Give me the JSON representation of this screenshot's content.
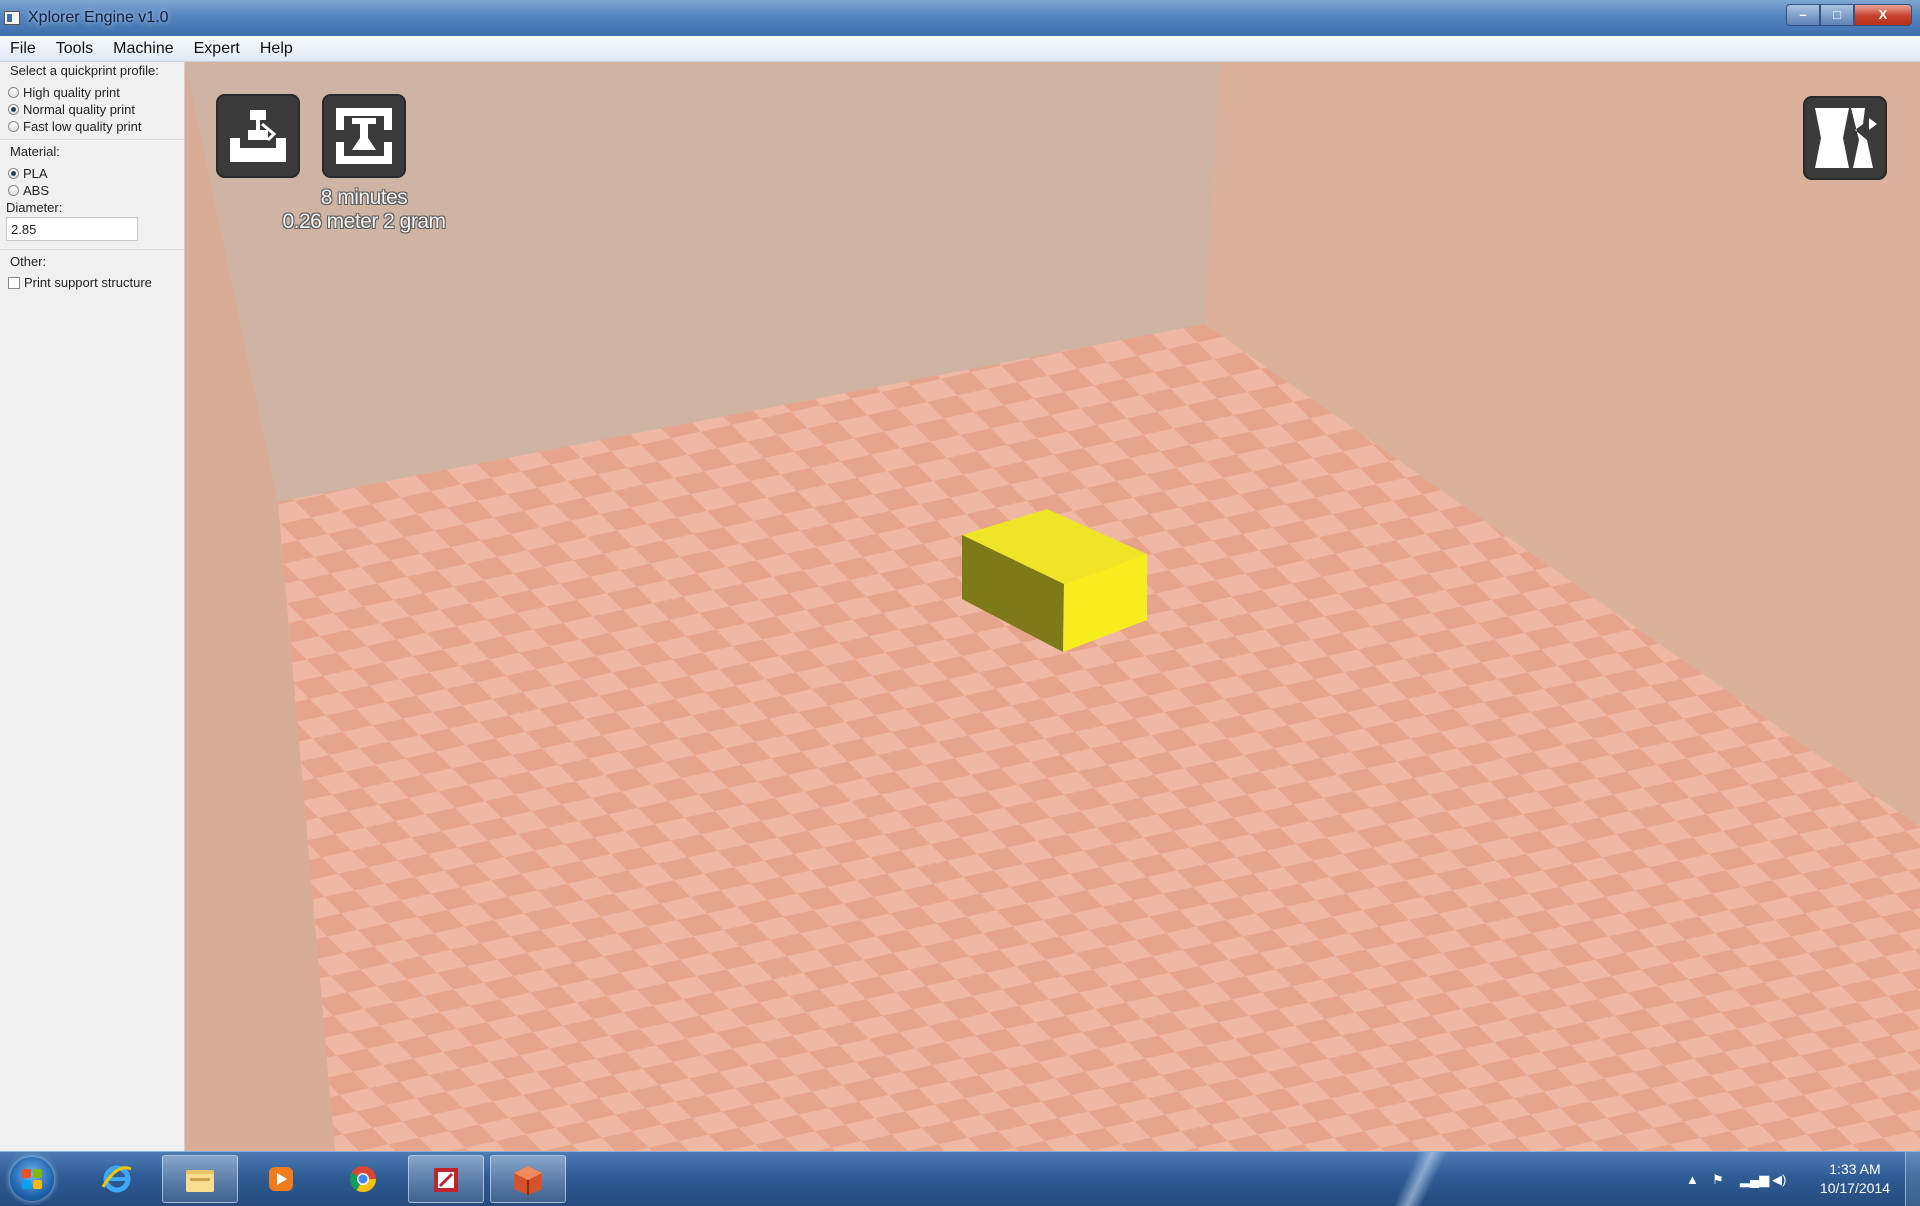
{
  "window": {
    "title": "Xplorer Engine v1.0",
    "controls": {
      "minimize": "–",
      "maximize": "□",
      "close": "X"
    }
  },
  "menu": [
    "File",
    "Tools",
    "Machine",
    "Expert",
    "Help"
  ],
  "panel": {
    "profile_label": "Select a quickprint profile:",
    "profiles": [
      {
        "label": "High quality print",
        "checked": false
      },
      {
        "label": "Normal quality print",
        "checked": true
      },
      {
        "label": "Fast low quality print",
        "checked": false
      }
    ],
    "material_label": "Material:",
    "materials": [
      {
        "label": "PLA",
        "checked": true
      },
      {
        "label": "ABS",
        "checked": false
      }
    ],
    "diameter_label": "Diameter:",
    "diameter_value": "2.85",
    "other_label": "Other:",
    "support_label": "Print support structure",
    "support_checked": false
  },
  "viewport": {
    "toolbar": [
      {
        "name": "load-model",
        "icon": "load-icon"
      },
      {
        "name": "print",
        "icon": "print-icon"
      }
    ],
    "view_mode_icon": "view-mode-icon",
    "print_time": "8 minutes",
    "print_material": "0.26 meter 2 gram",
    "colors": {
      "back_wall": "#cfb3a3",
      "side_wall": "#dcb19c",
      "floor_light": "#e6a48c",
      "floor_dark": "#eeb8a4",
      "model_top": "#efe426",
      "model_front": "#f6ec1e",
      "model_side": "#7f7a18"
    }
  },
  "taskbar": {
    "apps": [
      "start-orb",
      "internet-explorer-icon",
      "file-explorer-icon",
      "media-player-icon",
      "chrome-icon",
      "paint-app-icon",
      "xplorer-engine-icon"
    ],
    "time": "1:33 AM",
    "date": "10/17/2014"
  }
}
